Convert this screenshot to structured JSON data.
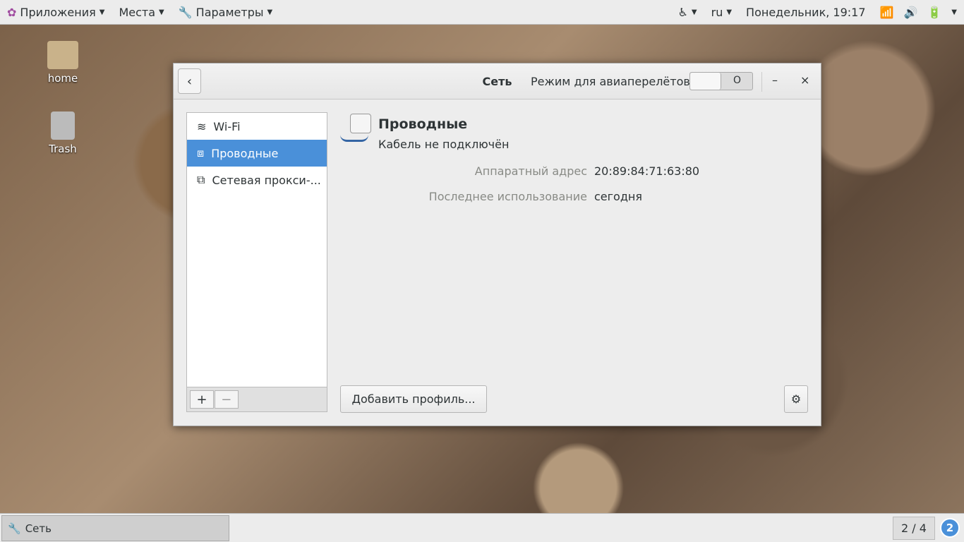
{
  "topbar": {
    "apps": "Приложения",
    "places": "Места",
    "settings": "Параметры",
    "lang": "ru",
    "clock": "Понедельник, 19:17"
  },
  "desktop": {
    "home": "home",
    "trash": "Trash"
  },
  "window": {
    "title": "Сеть",
    "airplane_label": "Режим для авиаперелётов",
    "airplane_state": "O",
    "minimize": "–",
    "close": "×",
    "sidebar": [
      {
        "label": "Wi-Fi"
      },
      {
        "label": "Проводные"
      },
      {
        "label": "Сетевая прокси-..."
      }
    ],
    "add": "+",
    "remove": "−",
    "device": {
      "name": "Проводные",
      "status": "Кабель не подключён"
    },
    "details": [
      {
        "label": "Аппаратный адрес",
        "value": "20:89:84:71:63:80"
      },
      {
        "label": "Последнее использование",
        "value": "сегодня"
      }
    ],
    "add_profile": "Добавить профиль..."
  },
  "taskbar": {
    "task": "Сеть",
    "workspace": "2 / 4",
    "badge": "2"
  }
}
